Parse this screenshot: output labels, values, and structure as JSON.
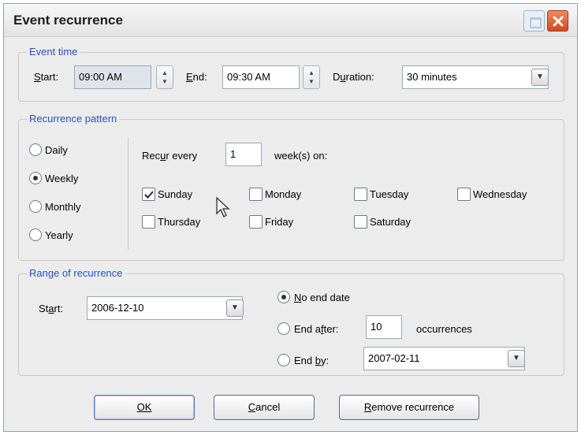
{
  "window": {
    "title": "Event recurrence",
    "restore_icon": "restore-icon",
    "close_icon": "close-icon"
  },
  "event_time": {
    "legend": "Event time",
    "start_label": "Start:",
    "start_value": "09:00 AM",
    "end_label": "End:",
    "end_value": "09:30 AM",
    "duration_label": "Duration:",
    "duration_value": "30 minutes"
  },
  "recurrence_pattern": {
    "legend": "Recurrence pattern",
    "options": [
      {
        "label": "Daily",
        "checked": false
      },
      {
        "label": "Weekly",
        "checked": true
      },
      {
        "label": "Monthly",
        "checked": false
      },
      {
        "label": "Yearly",
        "checked": false
      }
    ],
    "recur_every_label": "Recur every",
    "recur_every_value": "1",
    "weeks_on_label": "week(s) on:",
    "days": [
      {
        "label": "Sunday",
        "checked": true
      },
      {
        "label": "Monday",
        "checked": false
      },
      {
        "label": "Tuesday",
        "checked": false
      },
      {
        "label": "Wednesday",
        "checked": false
      },
      {
        "label": "Thursday",
        "checked": false
      },
      {
        "label": "Friday",
        "checked": false
      },
      {
        "label": "Saturday",
        "checked": false
      }
    ]
  },
  "range": {
    "legend": "Range of recurrence",
    "start_label": "Start:",
    "start_value": "2006-12-10",
    "no_end_label": "No end date",
    "end_after_label": "End after:",
    "end_after_value": "10",
    "occurrences_label": "occurrences",
    "end_by_label": "End by:",
    "end_by_value": "2007-02-11",
    "selected": "no_end"
  },
  "buttons": {
    "ok": "OK",
    "cancel": "Cancel",
    "remove": "Remove recurrence"
  },
  "colors": {
    "legend": "#2452b8",
    "close_button": "#d4471f"
  }
}
